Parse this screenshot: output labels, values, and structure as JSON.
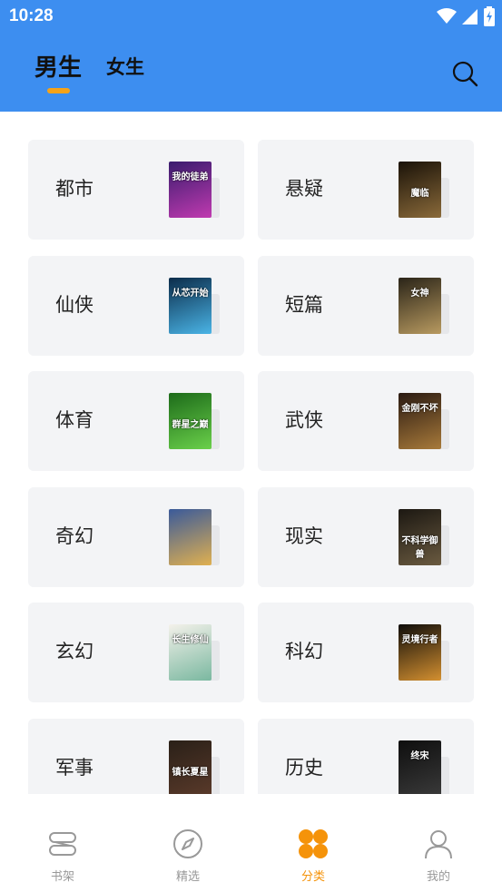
{
  "status_bar": {
    "time": "10:28"
  },
  "header": {
    "tabs": [
      {
        "label": "男生",
        "active": true
      },
      {
        "label": "女生",
        "active": false
      }
    ],
    "accent_color": "#3d8ef0",
    "indicator_color": "#f5a31a"
  },
  "categories": [
    {
      "label": "都市",
      "cover_title": "我的徒弟",
      "cover_colors": [
        "#3a1c6e",
        "#c03ab0"
      ]
    },
    {
      "label": "悬疑",
      "cover_title": "魔临",
      "cover_colors": [
        "#1a1208",
        "#8a6a3a"
      ]
    },
    {
      "label": "仙侠",
      "cover_title": "从芯开始",
      "cover_colors": [
        "#0b2c4a",
        "#4ab4e6"
      ]
    },
    {
      "label": "短篇",
      "cover_title": "女神",
      "cover_colors": [
        "#2a2418",
        "#b89a60"
      ]
    },
    {
      "label": "体育",
      "cover_title": "群星之巅",
      "cover_colors": [
        "#1d6b1a",
        "#6ad04a"
      ]
    },
    {
      "label": "武侠",
      "cover_title": "金刚不坏",
      "cover_colors": [
        "#2a1a12",
        "#a87a3a"
      ]
    },
    {
      "label": "奇幻",
      "cover_title": "",
      "cover_colors": [
        "#3a5a9a",
        "#e0b050"
      ]
    },
    {
      "label": "现实",
      "cover_title": "不科学御兽",
      "cover_colors": [
        "#1c1812",
        "#6a5a40"
      ]
    },
    {
      "label": "玄幻",
      "cover_title": "长生修仙",
      "cover_colors": [
        "#f4f1ea",
        "#7ab8a0"
      ]
    },
    {
      "label": "科幻",
      "cover_title": "灵境行者",
      "cover_colors": [
        "#0e0c0a",
        "#d49030"
      ]
    },
    {
      "label": "军事",
      "cover_title": "镇长夏星",
      "cover_colors": [
        "#2a2018",
        "#5a3a2a"
      ]
    },
    {
      "label": "历史",
      "cover_title": "终宋",
      "cover_colors": [
        "#0e0e0e",
        "#3a3a3a"
      ]
    }
  ],
  "bottom_nav": [
    {
      "label": "书架",
      "icon": "bookshelf-icon",
      "active": false
    },
    {
      "label": "精选",
      "icon": "compass-icon",
      "active": false
    },
    {
      "label": "分类",
      "icon": "category-icon",
      "active": true
    },
    {
      "label": "我的",
      "icon": "profile-icon",
      "active": false
    }
  ],
  "active_color": "#f5930a"
}
